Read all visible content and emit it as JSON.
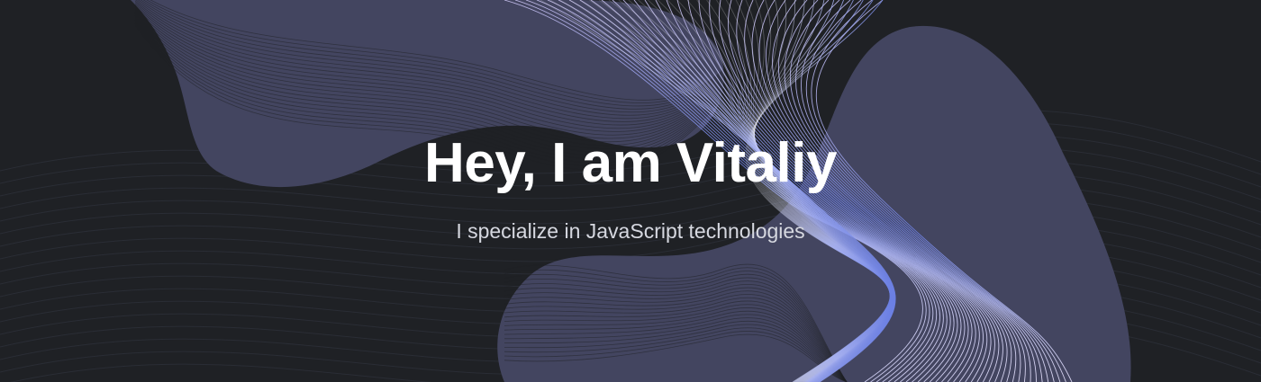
{
  "hero": {
    "title": "Hey, I am Vitaliy",
    "subtitle": "I specialize in JavaScript technologies"
  },
  "colors": {
    "background": "#1f2125",
    "blob": "#434560",
    "wave_accent": "#6b7fe3",
    "wave_light": "#c9c2f0",
    "title": "#ffffff",
    "subtitle": "#d6d8e0"
  },
  "decorations": {
    "background_art": "abstract-blob-wave-lines"
  }
}
